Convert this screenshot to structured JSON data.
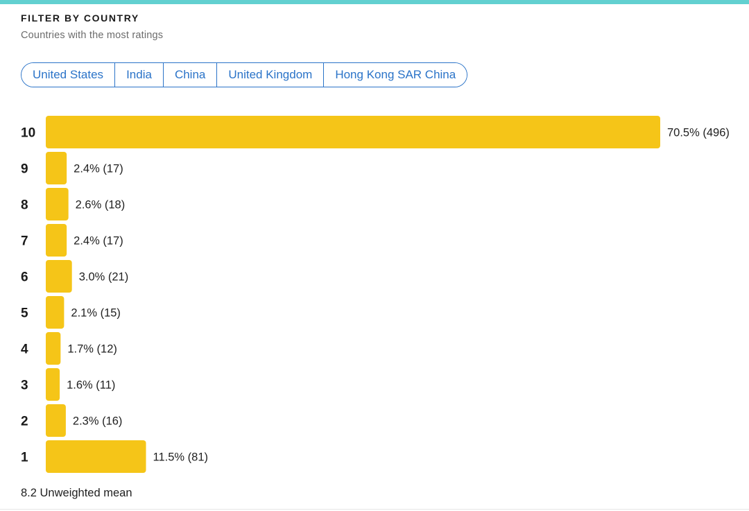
{
  "header": {
    "heading": "FILTER BY COUNTRY",
    "subheading": "Countries with the most ratings"
  },
  "countries": [
    "United States",
    "India",
    "China",
    "United Kingdom",
    "Hong Kong SAR China"
  ],
  "colors": {
    "accent_top": "#62d0d0",
    "bar": "#f5c518",
    "link": "#2a73c8"
  },
  "chart_data": {
    "type": "bar",
    "orientation": "horizontal",
    "categories": [
      "10",
      "9",
      "8",
      "7",
      "6",
      "5",
      "4",
      "3",
      "2",
      "1"
    ],
    "values": [
      70.5,
      2.4,
      2.6,
      2.4,
      3.0,
      2.1,
      1.7,
      1.6,
      2.3,
      11.5
    ],
    "counts": [
      496,
      17,
      18,
      17,
      21,
      15,
      12,
      11,
      16,
      81
    ],
    "labels": [
      "70.5% (496)",
      "2.4% (17)",
      "2.6% (18)",
      "2.4% (17)",
      "3.0% (21)",
      "2.1% (15)",
      "1.7% (12)",
      "1.6% (11)",
      "2.3% (16)",
      "11.5% (81)"
    ],
    "xlim": [
      0,
      70.5
    ],
    "grid": false
  },
  "summary": {
    "mean_text": "8.2 Unweighted mean"
  }
}
